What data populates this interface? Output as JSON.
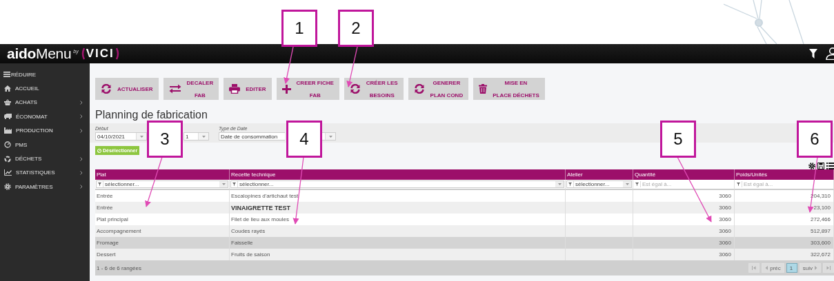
{
  "header": {
    "brand": "**aido**Menu",
    "by": "by",
    "partner": "VICI"
  },
  "sidebar": {
    "items": [
      {
        "label": "RÉDUIRE",
        "expandable": false
      },
      {
        "label": "ACCUEIL",
        "expandable": false
      },
      {
        "label": "ACHATS",
        "expandable": true
      },
      {
        "label": "ÉCONOMAT",
        "expandable": true
      },
      {
        "label": "PRODUCTION",
        "expandable": true
      },
      {
        "label": "PMS",
        "expandable": false
      },
      {
        "label": "DÉCHETS",
        "expandable": true
      },
      {
        "label": "STATISTIQUES",
        "expandable": true
      },
      {
        "label": "PARAMÈTRES",
        "expandable": true
      }
    ]
  },
  "toolbar": [
    {
      "line1": "ACTUALISER"
    },
    {
      "line1": "DECALER",
      "line2": "FAB"
    },
    {
      "line1": "EDITER"
    },
    {
      "line1": "CREER FICHE",
      "line2": "FAB"
    },
    {
      "line1": "CRÉER LES",
      "line2": "BESOINS"
    },
    {
      "line1": "GENERER",
      "line2": "PLAN COND"
    },
    {
      "line1": "MISE EN",
      "line2": "PLACE DÉCHETS"
    }
  ],
  "title": "Planning de fabrication",
  "filters": {
    "start_label": "Début",
    "start_value": "04/10/2021",
    "end_value": "1",
    "type_label": "Type de Date",
    "type_value": "Date de consommation"
  },
  "deselect_button": "Désélectionner",
  "table": {
    "columns": [
      {
        "label": "Plat",
        "filter": "sélectionner...",
        "kind": "select"
      },
      {
        "label": "Recette technique",
        "filter": "sélectionner...",
        "kind": "select"
      },
      {
        "label": "Atelier",
        "filter": "sélectionner...",
        "kind": "select"
      },
      {
        "label": "Quantité",
        "filter": "Est égal à...",
        "kind": "number"
      },
      {
        "label": "Poids/Unités",
        "filter": "Est égal à...",
        "kind": "number"
      }
    ],
    "rows": [
      {
        "plat": "Entrée",
        "recette": "Escalopines d'artichaut test",
        "recette_bold": false,
        "quantite": "3060",
        "poids": "204,310",
        "selected": false
      },
      {
        "plat": "Entrée",
        "recette": "VINAIGRETTE TEST",
        "recette_bold": true,
        "quantite": "3060",
        "poids": "23,100",
        "selected": false
      },
      {
        "plat": "Plat principal",
        "recette": "Filet de lieu aux moules",
        "recette_bold": false,
        "quantite": "3060",
        "poids": "272,466",
        "selected": false
      },
      {
        "plat": "Accompagnement",
        "recette": "Coudes rayés",
        "recette_bold": false,
        "quantite": "3060",
        "poids": "512,897",
        "selected": false
      },
      {
        "plat": "Fromage",
        "recette": "Faisselle",
        "recette_bold": false,
        "quantite": "3060",
        "poids": "303,600",
        "selected": true
      },
      {
        "plat": "Dessert",
        "recette": "Fruits de saison",
        "recette_bold": false,
        "quantite": "3060",
        "poids": "322,672",
        "selected": false
      }
    ],
    "footer": "1 - 6 de 6 rangées",
    "pager": {
      "prev": "préc",
      "next": "suiv",
      "pages": [
        {
          "label": "1",
          "selected": true
        }
      ]
    }
  },
  "callouts": [
    {
      "number": "1"
    },
    {
      "number": "2"
    },
    {
      "number": "3"
    },
    {
      "number": "4"
    },
    {
      "number": "5"
    },
    {
      "number": "6"
    }
  ]
}
